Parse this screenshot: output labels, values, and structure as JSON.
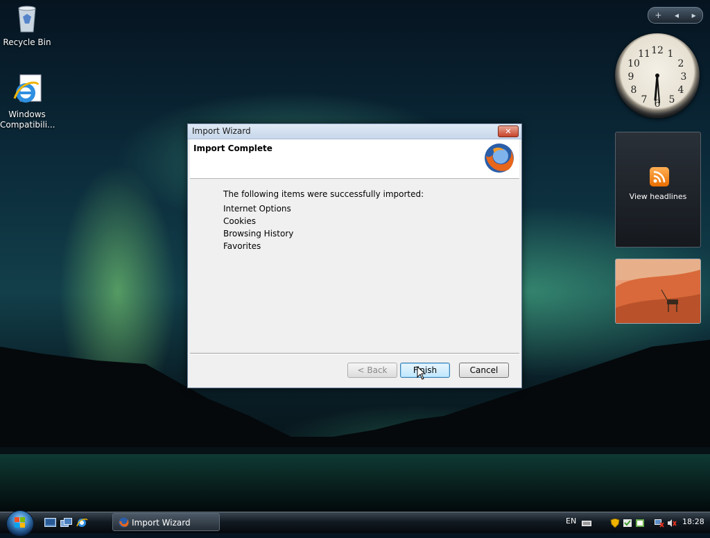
{
  "desktop": {
    "icons": [
      {
        "label": "Recycle Bin",
        "icon": "recycle-bin-icon"
      },
      {
        "label": "Windows Compatibili...",
        "icon": "internet-explorer-icon"
      }
    ]
  },
  "sidebar": {
    "controls": [
      "+",
      "◂",
      "▸"
    ],
    "clock": {
      "time": "18:28"
    },
    "feed": {
      "label": "View headlines",
      "icon": "rss-icon"
    }
  },
  "dialog": {
    "title": "Import Wizard",
    "close_label": "✕",
    "header_title": "Import Complete",
    "intro": "The following items were successfully imported:",
    "items": [
      "Internet Options",
      "Cookies",
      "Browsing History",
      "Favorites"
    ],
    "buttons": {
      "back": "< Back",
      "finish": "Finish",
      "cancel": "Cancel"
    }
  },
  "taskbar": {
    "task_label": "Import Wizard",
    "language": "EN",
    "time": "18:28"
  },
  "colors": {
    "dialog_border": "#6f86a3",
    "primary_button": "#bee6fd",
    "firefox_orange": "#e8661a",
    "firefox_blue": "#2a5ea8"
  }
}
